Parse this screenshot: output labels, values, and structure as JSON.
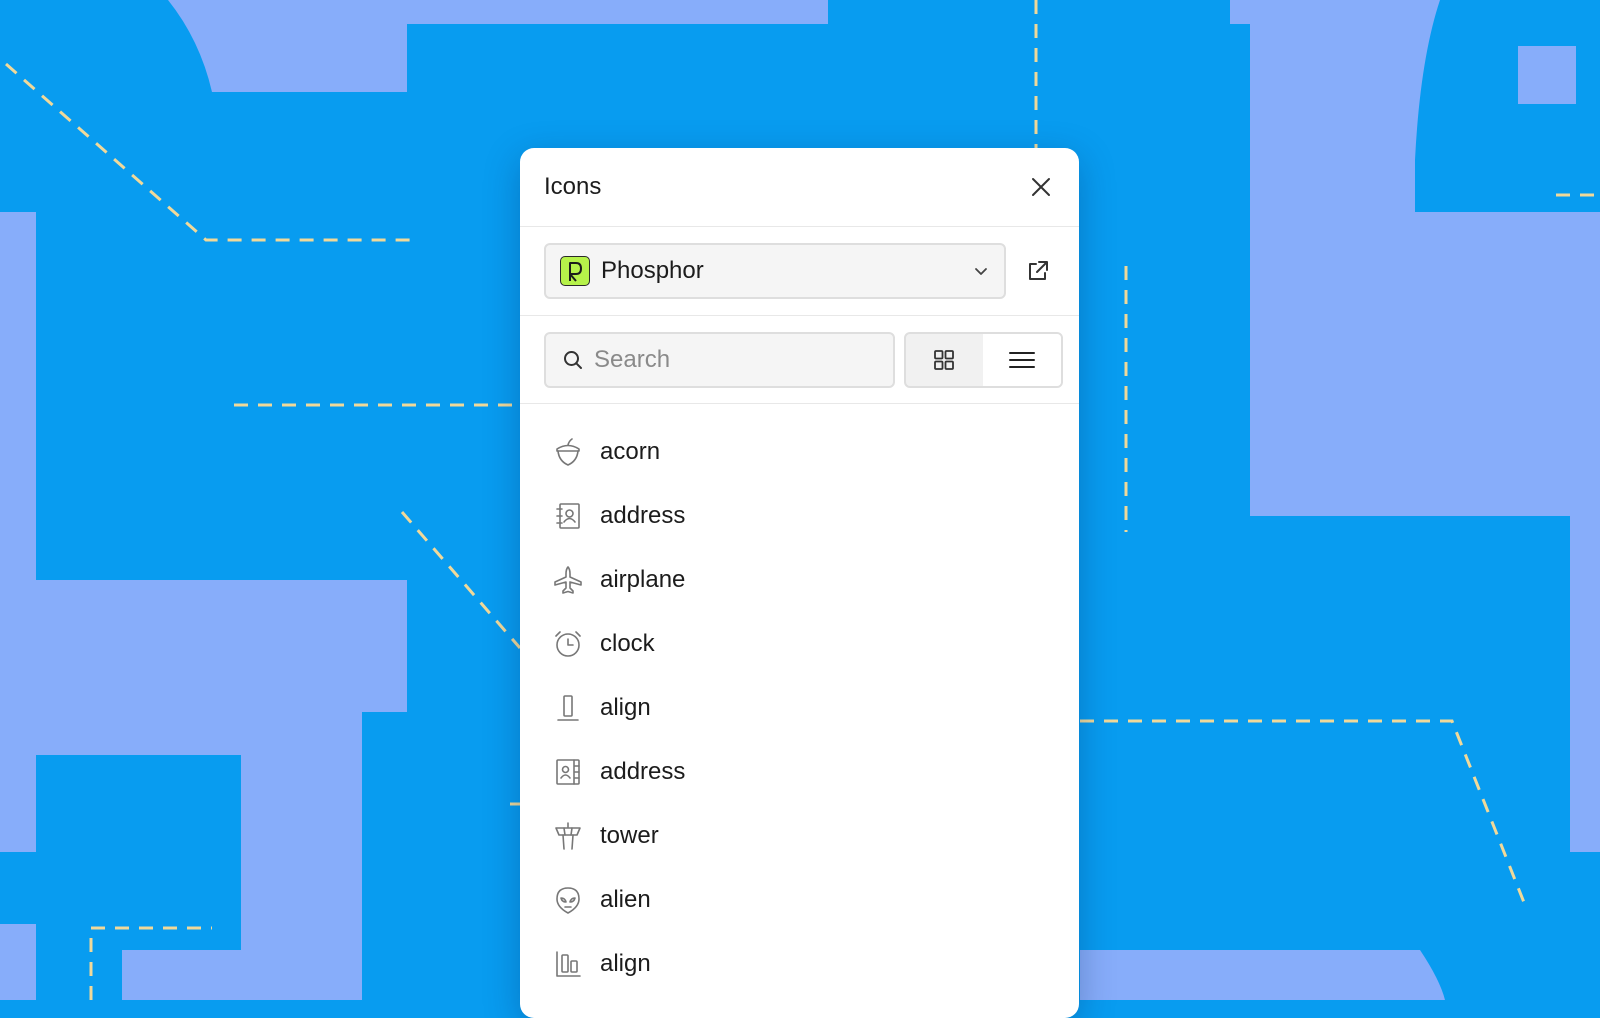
{
  "panel": {
    "title": "Icons",
    "close_icon": "close-icon"
  },
  "library": {
    "selected": "Phosphor",
    "logo_icon": "phosphor-logo",
    "dropdown_icon": "chevron-down-icon",
    "external_icon": "external-link-icon"
  },
  "search": {
    "placeholder": "Search",
    "value": ""
  },
  "view_toggle": {
    "options": [
      "grid",
      "list"
    ],
    "active": "list"
  },
  "icons": [
    {
      "label": "acorn",
      "icon": "acorn-icon"
    },
    {
      "label": "address",
      "icon": "address-book-icon"
    },
    {
      "label": "airplane",
      "icon": "airplane-icon"
    },
    {
      "label": "clock",
      "icon": "alarm-clock-icon"
    },
    {
      "label": "align",
      "icon": "align-bottom-icon"
    },
    {
      "label": "address",
      "icon": "address-book-tabs-icon"
    },
    {
      "label": "tower",
      "icon": "airplane-tower-icon"
    },
    {
      "label": "alien",
      "icon": "alien-icon"
    },
    {
      "label": "align",
      "icon": "align-bottom-simple-icon"
    }
  ],
  "colors": {
    "background_blue": "#089cf0",
    "background_shape": "#87adfa",
    "dashed_line": "#f0d99a",
    "logo_green": "#b6f24a"
  }
}
